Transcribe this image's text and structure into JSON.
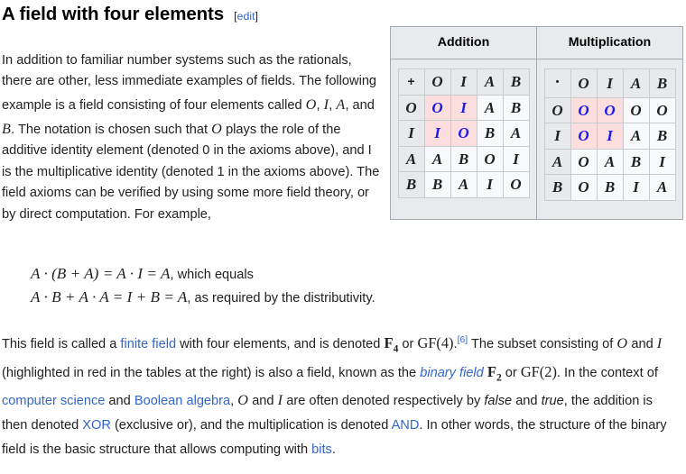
{
  "heading": {
    "title": "A field with four elements",
    "edit_open": "[",
    "edit_label": "edit",
    "edit_close": "]"
  },
  "intro": {
    "s1": "In addition to familiar number systems such as the rationals, there are other, less immediate examples of fields. The following example is a field consisting of four elements called ",
    "v_O": "O",
    "c1": ", ",
    "v_I": "I",
    "c2": ", ",
    "v_A": "A",
    "c3": ", and ",
    "v_B": "B",
    "s2": ". The notation is chosen such that ",
    "v_O2": "O",
    "s3": " plays the role of the additive identity element (denoted 0 in the axioms above), and I is the multiplicative identity (denoted 1 in the axioms above). The field axioms can be verified by using some more field theory, or by direct computation. For example,"
  },
  "math": {
    "line1": {
      "expr": "A · (B + A) = A · I = A",
      "tail": ", which equals"
    },
    "line2": {
      "expr": "A · B + A · A = I + B = A",
      "tail": ", as required by the distributivity."
    }
  },
  "tables": {
    "addition": {
      "title": "Addition",
      "operator": "+",
      "col_headers": [
        "O",
        "I",
        "A",
        "B"
      ],
      "row_headers": [
        "O",
        "I",
        "A",
        "B"
      ],
      "rows": [
        [
          "O",
          "I",
          "A",
          "B"
        ],
        [
          "I",
          "O",
          "B",
          "A"
        ],
        [
          "A",
          "B",
          "O",
          "I"
        ],
        [
          "B",
          "A",
          "I",
          "O"
        ]
      ],
      "highlight_rows": [
        0,
        1
      ],
      "highlight_cols": [
        0,
        1
      ]
    },
    "multiplication": {
      "title": "Multiplication",
      "operator": "·",
      "col_headers": [
        "O",
        "I",
        "A",
        "B"
      ],
      "row_headers": [
        "O",
        "I",
        "A",
        "B"
      ],
      "rows": [
        [
          "O",
          "O",
          "O",
          "O"
        ],
        [
          "O",
          "I",
          "A",
          "B"
        ],
        [
          "O",
          "A",
          "B",
          "I"
        ],
        [
          "O",
          "B",
          "I",
          "A"
        ]
      ],
      "highlight_rows": [
        0,
        1
      ],
      "highlight_cols": [
        0,
        1
      ]
    }
  },
  "outro": {
    "t1": "This field is called a ",
    "link_finite_field": "finite field",
    "t2": " with four elements, and is denoted ",
    "f4_letter": "F",
    "f4_sub": "4",
    "t3": " or ",
    "gf4": "GF(4)",
    "t4": ".",
    "ref6": "[6]",
    "t5": " The subset consisting of ",
    "v_O": "O",
    "t6": " and ",
    "v_I": "I",
    "t7": " (highlighted in red in the tables at the right) is also a field, known as the ",
    "link_binary_field": "binary field",
    "t8": " ",
    "f2_letter": "F",
    "f2_sub": "2",
    "t9": " or ",
    "gf2": "GF(2)",
    "t10": ". In the context of ",
    "link_computer_science": "computer science",
    "t11": " and ",
    "link_boolean_algebra": "Boolean algebra",
    "t12": ", ",
    "v_O2": "O",
    "t13": " and ",
    "v_I2": "I",
    "t14": " are often denoted respectively by ",
    "em_false": "false",
    "t15": " and ",
    "em_true": "true",
    "t16": ", the addition is then denoted ",
    "link_xor": "XOR",
    "t17": " (exclusive or), and the multiplication is denoted ",
    "link_and": "AND",
    "t18": ". In other words, the structure of the binary field is the basic structure that allows computing with ",
    "link_bits": "bits",
    "t19": "."
  },
  "colors": {
    "link": "#3366cc",
    "highlight_bg": "#fddede",
    "highlight_text": "#1a1aee",
    "table_border": "#a2a9b1",
    "header_bg": "#e7e9eb",
    "box_bg": "#e8eaec"
  }
}
